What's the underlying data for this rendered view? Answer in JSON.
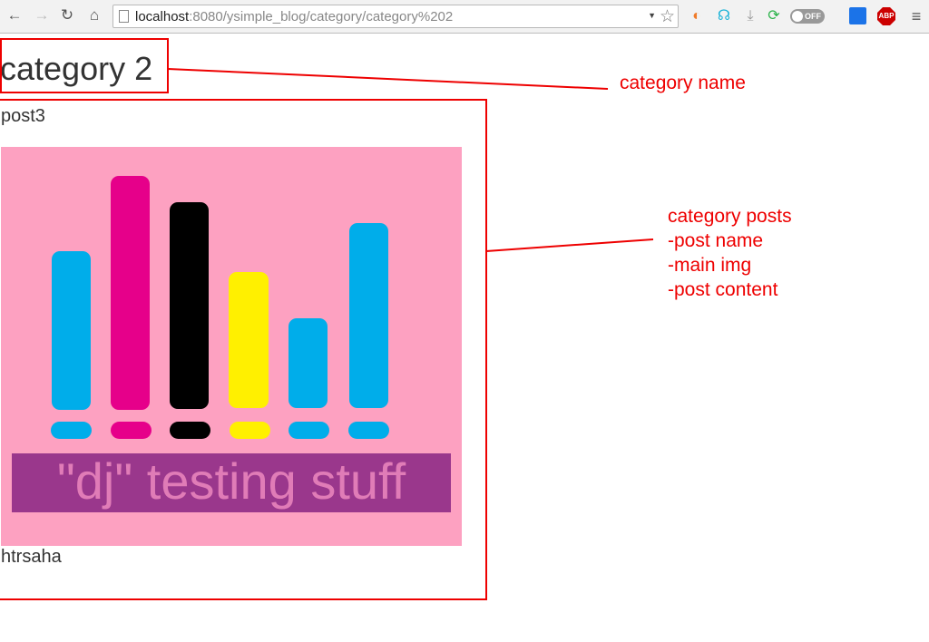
{
  "browser": {
    "url_host": "localhost",
    "url_rest": ":8080/ysimple_blog/category/category%202",
    "toggle_label": "OFF",
    "abp_label": "ABP",
    "icons": [
      "back-icon",
      "forward-icon",
      "reload-icon",
      "home-icon",
      "page-icon",
      "star-icon",
      "pacman-extension-icon",
      "headphones-extension-icon",
      "download-icon",
      "download-green-icon",
      "toggle-icon",
      "window-extension-icon",
      "adblock-icon",
      "menu-icon"
    ]
  },
  "page": {
    "category_title": "category 2",
    "posts": [
      {
        "name": "post3",
        "image_text": "\"dj\" testing stuff",
        "content": "htrsaha"
      }
    ]
  },
  "annotations": {
    "category_name": "category name",
    "category_posts": [
      "category posts",
      "-post name",
      "-main img",
      "-post content"
    ],
    "color": "#ee0000"
  },
  "logo_colors": [
    "#00adea",
    "#e6008a",
    "#000000",
    "#fff000",
    "#00adea",
    "#00adea"
  ]
}
